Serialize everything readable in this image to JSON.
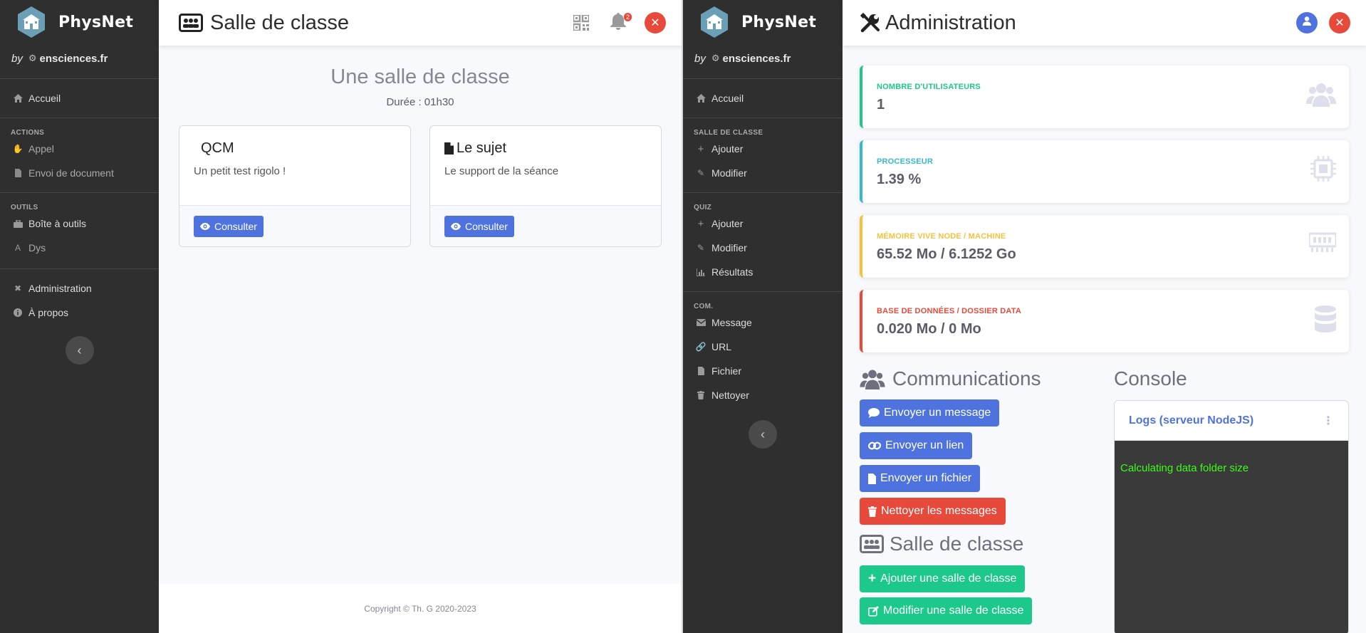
{
  "brand": {
    "name": "PhysNet",
    "by": "by",
    "site": "ensciences.fr"
  },
  "left": {
    "sidebar": {
      "home": "Accueil",
      "actions_heading": "ACTIONS",
      "actions": [
        "Appel",
        "Envoi de document"
      ],
      "tools_heading": "OUTILS",
      "tools": [
        "Boîte à outils",
        "Dys"
      ],
      "admin": "Administration",
      "about": "À propos"
    },
    "topbar": {
      "title": "Salle de classe",
      "notification_count": "2"
    },
    "main": {
      "heading": "Une salle de classe",
      "duration": "Durée : 01h30",
      "cards": [
        {
          "title": "QCM",
          "text": "Un petit test rigolo !",
          "button": "Consulter"
        },
        {
          "title": "Le sujet",
          "text": "Le support de la séance",
          "button": "Consulter"
        }
      ]
    },
    "footer": "Copyright © Th. G 2020-2023"
  },
  "right": {
    "sidebar": {
      "home": "Accueil",
      "classroom_heading": "SALLE DE CLASSE",
      "classroom": [
        "Ajouter",
        "Modifier"
      ],
      "quiz_heading": "QUIZ",
      "quiz": [
        "Ajouter",
        "Modifier",
        "Résultats"
      ],
      "com_heading": "COM.",
      "com": [
        "Message",
        "URL",
        "Fichier",
        "Nettoyer"
      ]
    },
    "topbar": {
      "title": "Administration"
    },
    "stats": [
      {
        "label": "NOMBRE D'UTILISATEURS",
        "value": "1",
        "color": "#1cc88a",
        "icon": "users-icon"
      },
      {
        "label": "PROCESSEUR",
        "value": "1.39 %",
        "color": "#36b9cc",
        "icon": "cpu-icon"
      },
      {
        "label": "MÉMOIRE VIVE NODE / MACHINE",
        "value": "65.52 Mo / 6.1252 Go",
        "color": "#f6c23e",
        "icon": "memory-icon"
      },
      {
        "label": "BASE DE DONNÉES / DOSSIER DATA",
        "value": "0.020 Mo / 0 Mo",
        "color": "#e74a3b",
        "icon": "database-icon"
      }
    ],
    "communications": {
      "title": "Communications",
      "buttons": [
        "Envoyer un message",
        "Envoyer un lien",
        "Envoyer un fichier",
        "Nettoyer les messages"
      ]
    },
    "classroom": {
      "title": "Salle de classe",
      "buttons": [
        "Ajouter une salle de classe",
        "Modifier une salle de classe"
      ]
    },
    "console": {
      "title": "Console",
      "card_title": "Logs (serveur NodeJS)",
      "log": "Calculating data folder size"
    }
  },
  "colors": {
    "primary": "#4e73df",
    "success": "#1cc88a",
    "danger": "#e74a3b",
    "info": "#36b9cc",
    "warning": "#f6c23e",
    "sidebar": "#2f2f2f"
  }
}
